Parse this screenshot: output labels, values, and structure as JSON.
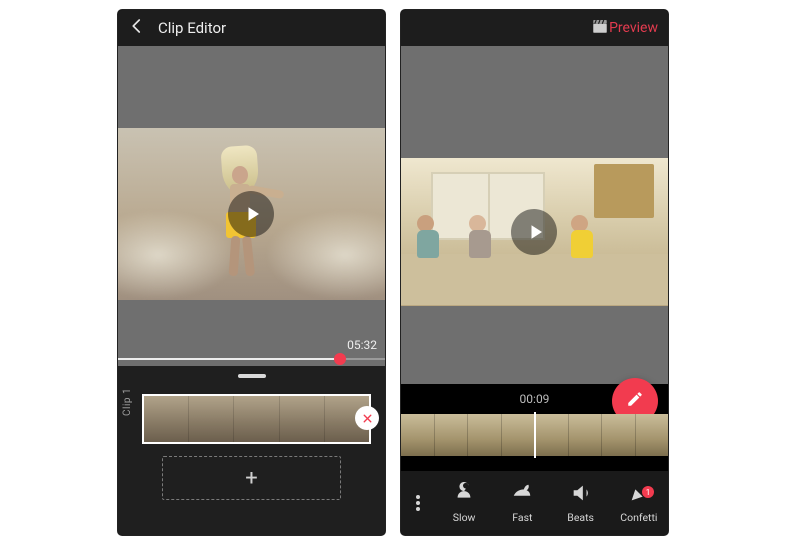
{
  "left": {
    "title": "Clip Editor",
    "timecode": "05:32",
    "clip_label": "Clip 1",
    "add_label": "+",
    "scrub_progress": 0.83
  },
  "right": {
    "preview_label": "Preview",
    "timecode": "00:09",
    "tools": {
      "slow": "Slow",
      "fast": "Fast",
      "beats": "Beats",
      "confetti": "Confetti"
    },
    "confetti_badge": "1"
  }
}
